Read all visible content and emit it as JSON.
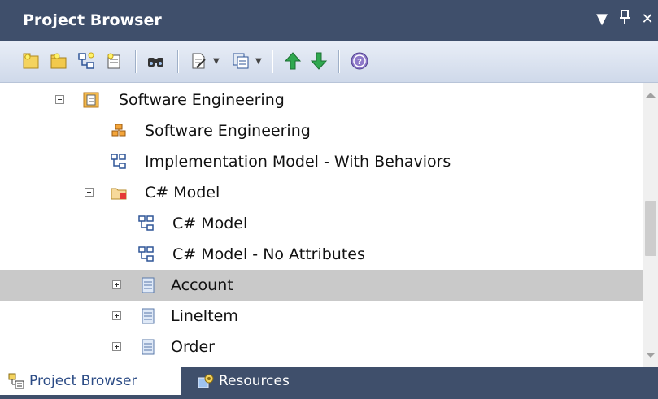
{
  "window": {
    "title": "Project Browser",
    "controls": [
      "▼",
      "ᵖ",
      "✕"
    ]
  },
  "toolbar": {
    "buttons": [
      {
        "icon": "new-model-icon"
      },
      {
        "icon": "new-package-icon"
      },
      {
        "icon": "new-diagram-icon"
      },
      {
        "icon": "new-element-icon"
      },
      {
        "icon": "find-icon"
      },
      {
        "icon": "document-icon"
      },
      {
        "icon": "copy-icon"
      },
      {
        "icon": "move-up-icon"
      },
      {
        "icon": "move-down-icon"
      },
      {
        "icon": "help-icon"
      }
    ]
  },
  "tree": {
    "rows": [
      {
        "label": "Software Engineering",
        "icon": "model-icon",
        "expander": "minus"
      },
      {
        "label": "Software Engineering",
        "icon": "package-element-icon",
        "expander": ""
      },
      {
        "label": "Implementation Model - With Behaviors",
        "icon": "diagram-icon",
        "expander": ""
      },
      {
        "label": "C# Model",
        "icon": "folder-icon",
        "expander": "minus"
      },
      {
        "label": "C# Model",
        "icon": "diagram-icon",
        "expander": ""
      },
      {
        "label": "C# Model - No Attributes",
        "icon": "diagram-icon",
        "expander": ""
      },
      {
        "label": "Account",
        "icon": "class-icon",
        "expander": "plus",
        "selected": true
      },
      {
        "label": "LineItem",
        "icon": "class-icon",
        "expander": "plus"
      },
      {
        "label": "Order",
        "icon": "class-icon",
        "expander": "plus"
      }
    ]
  },
  "tabs": {
    "project_browser": "Project Browser",
    "resources": "Resources"
  },
  "colors": {
    "titlebar": "#3f4f6b",
    "selection": "#c9c9c9",
    "tab_active_text": "#2b4b85"
  }
}
